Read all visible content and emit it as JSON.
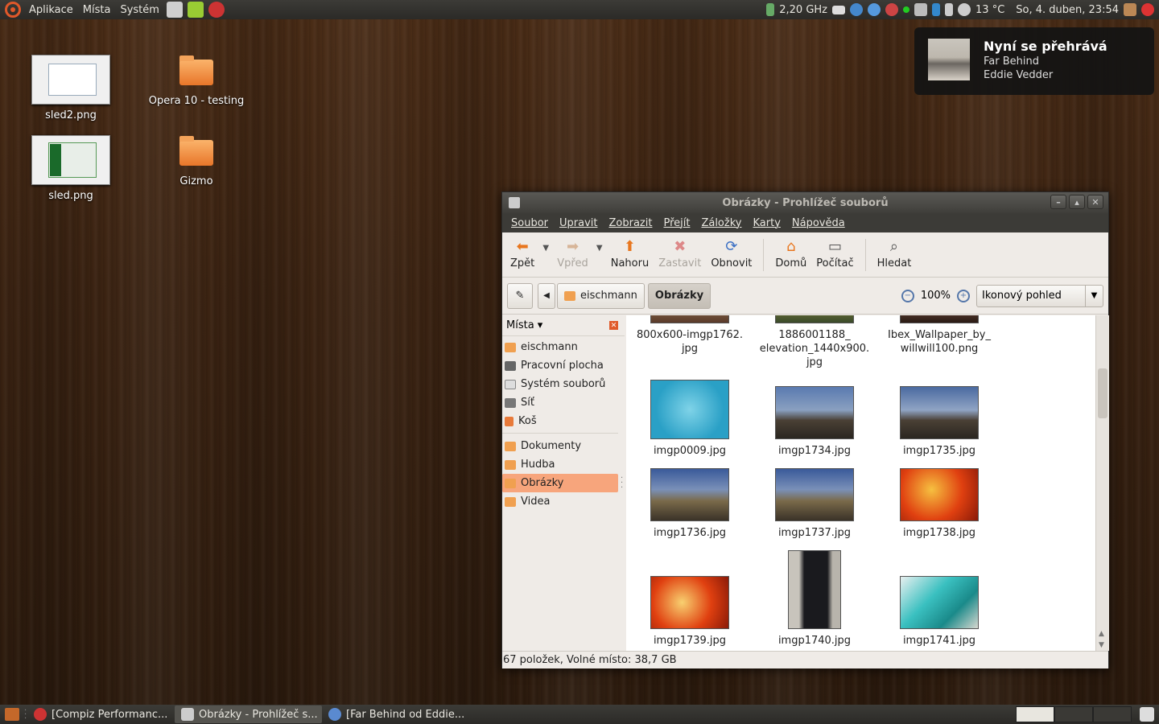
{
  "top_panel": {
    "menus": [
      "Aplikace",
      "Místa",
      "Systém"
    ],
    "cpu": "2,20 GHz",
    "weather": "13 °C",
    "clock": "So,  4. duben, 23:54"
  },
  "desktop": {
    "icons": [
      {
        "label": "sled2.png"
      },
      {
        "label": "Opera 10 - testing"
      },
      {
        "label": "sled.png"
      },
      {
        "label": "Gizmo"
      }
    ]
  },
  "notification": {
    "title": "Nyní se přehrává",
    "track": "Far Behind",
    "artist": "Eddie Vedder"
  },
  "window": {
    "title": "Obrázky - Prohlížeč souborů",
    "menu": [
      "Soubor",
      "Upravit",
      "Zobrazit",
      "Přejít",
      "Záložky",
      "Karty",
      "Nápověda"
    ],
    "toolbar": {
      "back": "Zpět",
      "forward": "Vpřed",
      "up": "Nahoru",
      "stop": "Zastavit",
      "reload": "Obnovit",
      "home": "Domů",
      "computer": "Počítač",
      "search": "Hledat"
    },
    "path": [
      "eischmann",
      "Obrázky"
    ],
    "zoom": "100%",
    "view": "Ikonový pohled",
    "sidebar": {
      "header": "Místa",
      "places": [
        "eischmann",
        "Pracovní plocha",
        "Systém souborů",
        "Síť",
        "Koš"
      ],
      "bookmarks": [
        "Dokumenty",
        "Hudba",
        "Obrázky",
        "Videa"
      ]
    },
    "files": [
      {
        "name": "800x600-imgp1762.\njpg"
      },
      {
        "name": "1886001188_\nelevation_1440x900.\njpg"
      },
      {
        "name": "Ibex_Wallpaper_by_\nwillwill100.png"
      },
      {
        "name": "imgp0009.jpg"
      },
      {
        "name": "imgp1734.jpg"
      },
      {
        "name": "imgp1735.jpg"
      },
      {
        "name": "imgp1736.jpg"
      },
      {
        "name": "imgp1737.jpg"
      },
      {
        "name": "imgp1738.jpg"
      },
      {
        "name": "imgp1739.jpg"
      },
      {
        "name": "imgp1740.jpg"
      },
      {
        "name": "imgp1741.jpg"
      }
    ],
    "status": "67 položek, Volné místo: 38,7 GB"
  },
  "taskbar": {
    "tasks": [
      "[Compiz Performanc...",
      "Obrázky - Prohlížeč s...",
      "[Far Behind od Eddie..."
    ]
  }
}
